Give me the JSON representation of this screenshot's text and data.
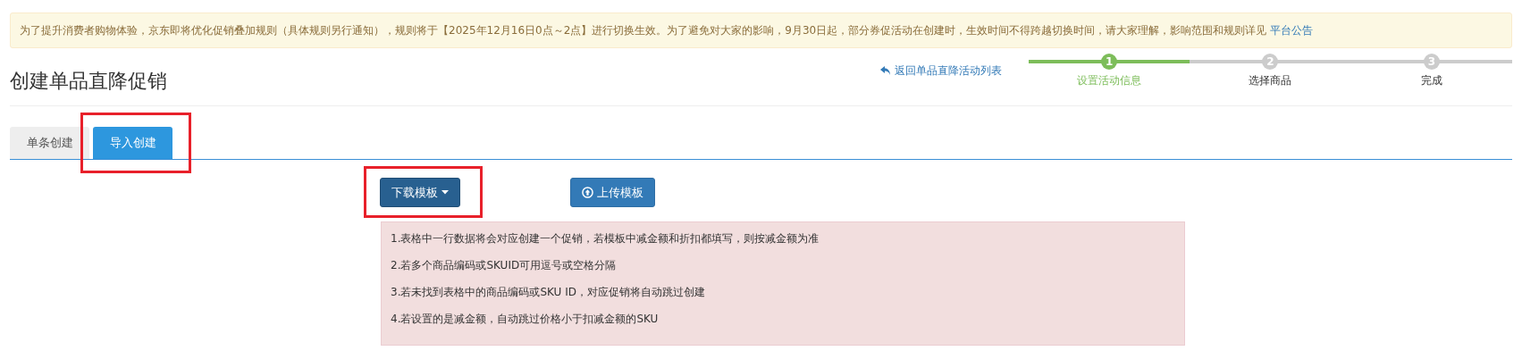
{
  "notice": {
    "text": "为了提升消费者购物体验，京东即将优化促销叠加规则（具体规则另行通知），规则将于【2025年12月16日0点～2点】进行切换生效。为了避免对大家的影响，9月30日起，部分券促活动在创建时，生效时间不得跨越切换时间，请大家理解，影响范围和规则详见",
    "link": "平台公告"
  },
  "page_title": "创建单品直降促销",
  "back_link": "返回单品直降活动列表",
  "steps": [
    {
      "number": "1",
      "label": "设置活动信息",
      "selected": true
    },
    {
      "number": "2",
      "label": "选择商品",
      "selected": false
    },
    {
      "number": "3",
      "label": "完成",
      "selected": false
    }
  ],
  "tabs": [
    {
      "label": "单条创建",
      "selected": false,
      "highlighted": false
    },
    {
      "label": "导入创建",
      "selected": true,
      "highlighted": true
    }
  ],
  "buttons": [
    {
      "kind": "dropdown",
      "label": "下载模板",
      "highlighted": true
    },
    {
      "kind": "upload",
      "label": "上传模板",
      "highlighted": false
    }
  ],
  "tips": [
    "1.表格中一行数据将会对应创建一个促销，若模板中减金额和折扣都填写，则按减金额为准",
    "2.若多个商品编码或SKUID可用逗号或空格分隔",
    "3.若未找到表格中的商品编码或SKU ID，对应促销将自动跳过创建",
    "4.若设置的是减金额，自动跳过价格小于扣减金额的SKU"
  ]
}
